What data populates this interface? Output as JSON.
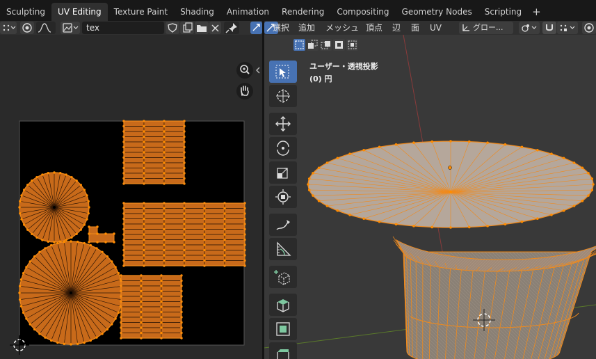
{
  "workspace_tabs": [
    "Sculpting",
    "UV Editing",
    "Texture Paint",
    "Shading",
    "Animation",
    "Rendering",
    "Compositing",
    "Geometry Nodes",
    "Scripting"
  ],
  "active_tab": "UV Editing",
  "add_workspace_label": "+",
  "uv_editor": {
    "image_name": "tex"
  },
  "viewport": {
    "menus": [
      "選択",
      "追加",
      "メッシュ",
      "頂点",
      "辺",
      "面",
      "UV"
    ],
    "transform_orientation": "グロー...",
    "view_name": "ユーザー・透視投影",
    "object_name": "(0) 円"
  },
  "colors": {
    "uv_fill": "#c86a1a",
    "uv_edge": "#f08a1c",
    "vertex": "#ff8c00",
    "active_tool": "#4772b3",
    "viewport_bg": "#393939"
  }
}
